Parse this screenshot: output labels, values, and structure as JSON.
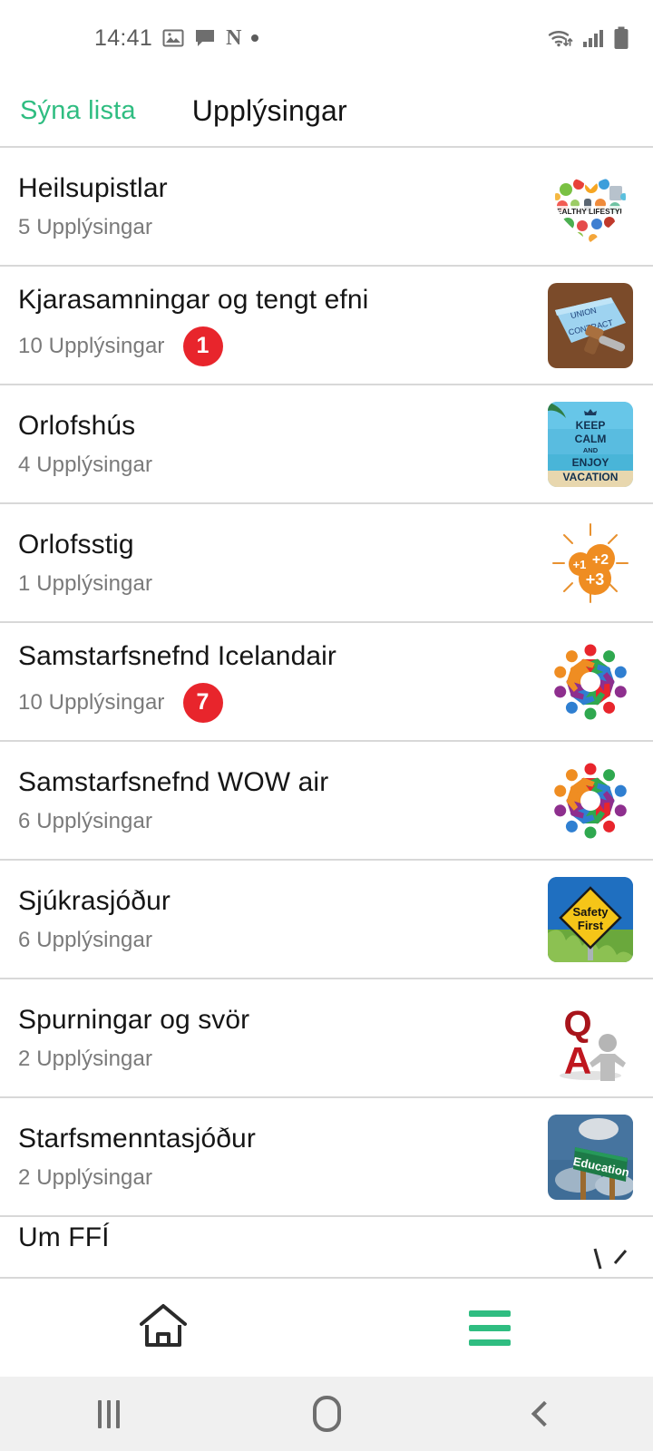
{
  "statusbar": {
    "time": "14:41",
    "left_icons": [
      "photo-icon",
      "chat-bubble-icon",
      "netflix-icon",
      "dot-icon"
    ],
    "netflix_glyph": "N",
    "right_icons": [
      "wifi-icon",
      "signal-icon",
      "battery-icon"
    ]
  },
  "appbar": {
    "show_list_label": "Sýna lista",
    "title": "Upplýsingar",
    "accent_color": "#2fbd81"
  },
  "list": {
    "items": [
      {
        "title": "Heilsupistlar",
        "subtitle": "5 Upplýsingar",
        "badge": "",
        "thumb": "healthy-lifestyle-heart-image"
      },
      {
        "title": "Kjarasamningar og tengt efni",
        "subtitle": "10 Upplýsingar",
        "badge": "1",
        "thumb": "union-contract-gavel-image"
      },
      {
        "title": "Orlofshús",
        "subtitle": "4 Upplýsingar",
        "badge": "",
        "thumb": "keep-calm-enjoy-vacation-image"
      },
      {
        "title": "Orlofsstig",
        "subtitle": "1 Upplýsingar",
        "badge": "",
        "thumb": "plus-points-sunburst-image"
      },
      {
        "title": "Samstarfsnefnd Icelandair",
        "subtitle": "10 Upplýsingar",
        "badge": "7",
        "thumb": "people-circle-image"
      },
      {
        "title": "Samstarfsnefnd WOW air",
        "subtitle": "6 Upplýsingar",
        "badge": "",
        "thumb": "people-circle-image"
      },
      {
        "title": "Sjúkrasjóður",
        "subtitle": "6 Upplýsingar",
        "badge": "",
        "thumb": "safety-first-sign-image"
      },
      {
        "title": "Spurningar og svör",
        "subtitle": "2 Upplýsingar",
        "badge": "",
        "thumb": "q-and-a-figure-image"
      },
      {
        "title": "Starfsmenntasjóður",
        "subtitle": "2 Upplýsingar",
        "badge": "",
        "thumb": "education-road-sign-image"
      }
    ],
    "partial_item": {
      "title": "Um FFÍ"
    },
    "badge_color": "#e8252c"
  },
  "tabbar": {
    "home_label": "home-tab",
    "menu_label": "menu-tab",
    "menu_color": "#2fbd81"
  },
  "navbar": {
    "recents_label": "recents",
    "home_label": "home",
    "back_label": "back"
  },
  "thumb_text": {
    "healthy": "HEALTHY LIFESTYLE",
    "contract_l1": "UNION",
    "contract_l2": "CONTRACT",
    "keepcalm_l1": "KEEP",
    "keepcalm_l2": "CALM",
    "keepcalm_l3": "AND",
    "keepcalm_l4": "ENJOY",
    "keepcalm_l5": "VACATION",
    "points_1": "+1",
    "points_2": "+2",
    "points_3": "+3",
    "safety_l1": "Safety",
    "safety_l2": "First",
    "qa_q": "Q",
    "qa_a": "A",
    "education": "Education"
  }
}
